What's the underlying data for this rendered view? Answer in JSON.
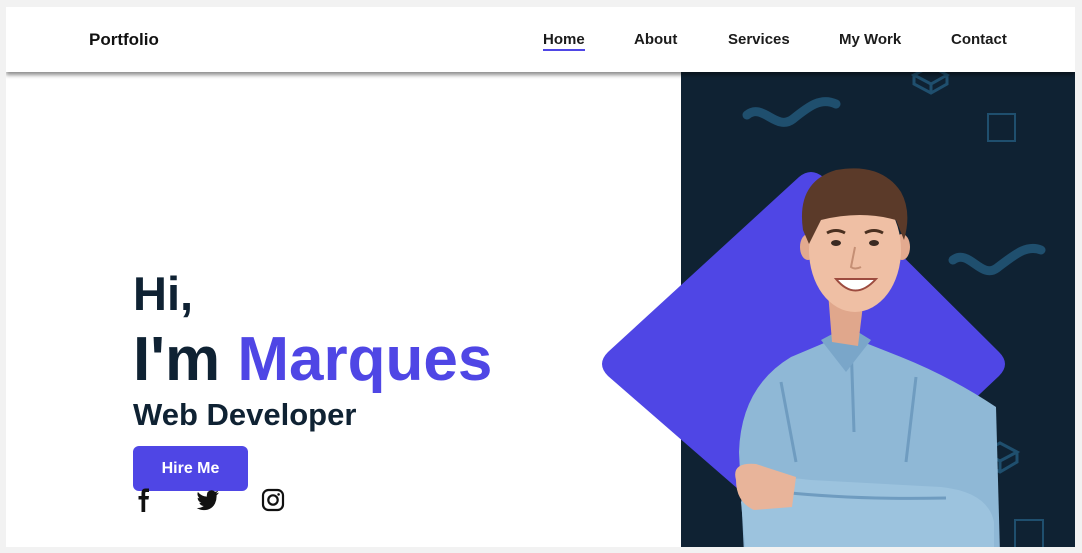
{
  "header": {
    "brand": "Portfolio",
    "nav": [
      {
        "label": "Home",
        "active": true
      },
      {
        "label": "About",
        "active": false
      },
      {
        "label": "Services",
        "active": false
      },
      {
        "label": "My Work",
        "active": false
      },
      {
        "label": "Contact",
        "active": false
      }
    ]
  },
  "hero": {
    "greeting": "Hi,",
    "intro_prefix": "I'm",
    "name": "Marques",
    "role": "Web Developer",
    "cta_label": "Hire Me"
  },
  "social": [
    {
      "icon": "facebook-icon"
    },
    {
      "icon": "twitter-icon"
    },
    {
      "icon": "instagram-icon"
    }
  ],
  "colors": {
    "accent": "#4f46e5",
    "dark_panel": "#0f2233",
    "deco_blue": "#1f4f6e",
    "text_dark": "#0f2233"
  }
}
